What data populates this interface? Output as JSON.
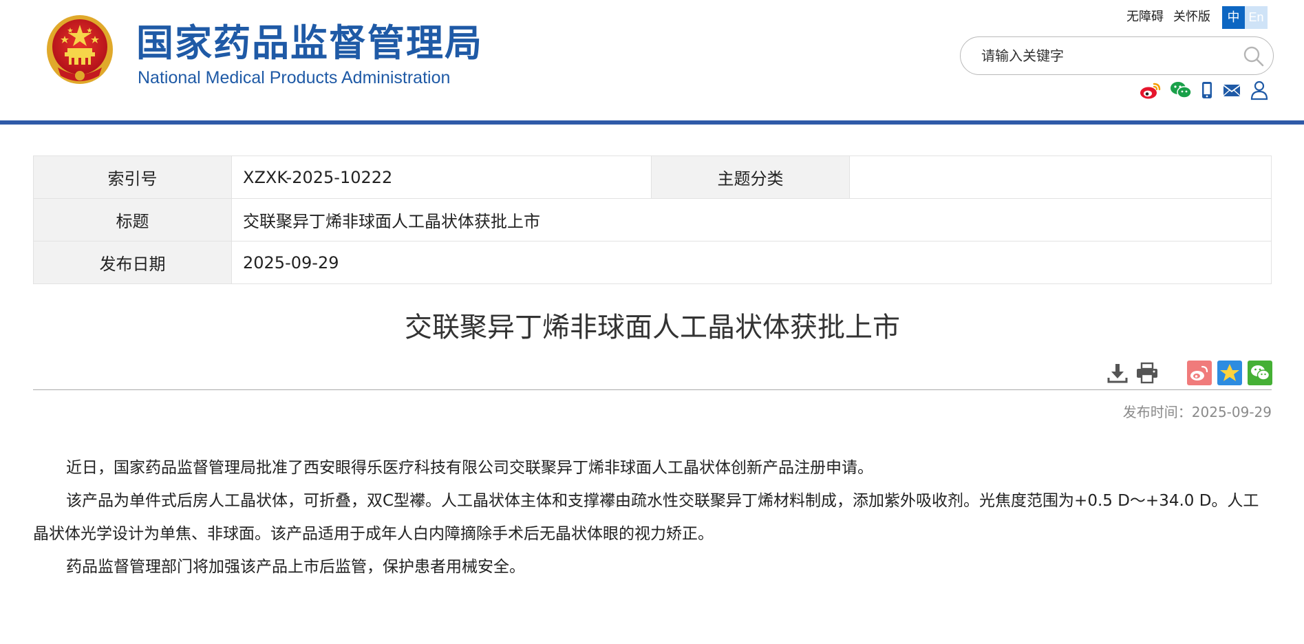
{
  "header": {
    "brand_cn": "国家药品监督管理局",
    "brand_en": "National Medical Products Administration",
    "links": {
      "accessibility": "无障碍",
      "elderly": "关怀版"
    },
    "lang": {
      "zh": "中",
      "en": "En"
    },
    "search": {
      "placeholder": "请输入关键字"
    },
    "social_icons": [
      "weibo-icon",
      "wechat-icon",
      "mobile-icon",
      "mail-icon",
      "user-icon"
    ],
    "colors": {
      "brand_blue": "#1f5aa6",
      "bar_blue": "#2f5aa8",
      "lang_active": "#0d66c2"
    }
  },
  "meta": {
    "index_label": "索引号",
    "index_value": "XZXK-2025-10222",
    "topic_label": "主题分类",
    "topic_value": "",
    "title_label": "标题",
    "title_value": "交联聚异丁烯非球面人工晶状体获批上市",
    "date_label": "发布日期",
    "date_value": "2025-09-29"
  },
  "article": {
    "title": "交联聚异丁烯非球面人工晶状体获批上市",
    "pubdate": "发布时间：2025-09-29",
    "tools": [
      "download-icon",
      "print-icon",
      "share-weibo-icon",
      "share-qzone-icon",
      "share-wechat-icon"
    ],
    "paragraphs": [
      "近日，国家药品监督管理局批准了西安眼得乐医疗科技有限公司交联聚异丁烯非球面人工晶状体创新产品注册申请。",
      "该产品为单件式后房人工晶状体，可折叠，双C型襻。人工晶状体主体和支撑襻由疏水性交联聚异丁烯材料制成，添加紫外吸收剂。光焦度范围为+0.5 D～+34.0 D。人工晶状体光学设计为单焦、非球面。该产品适用于成年人白内障摘除手术后无晶状体眼的视力矫正。",
      "药品监督管理部门将加强该产品上市后监管，保护患者用械安全。"
    ]
  }
}
